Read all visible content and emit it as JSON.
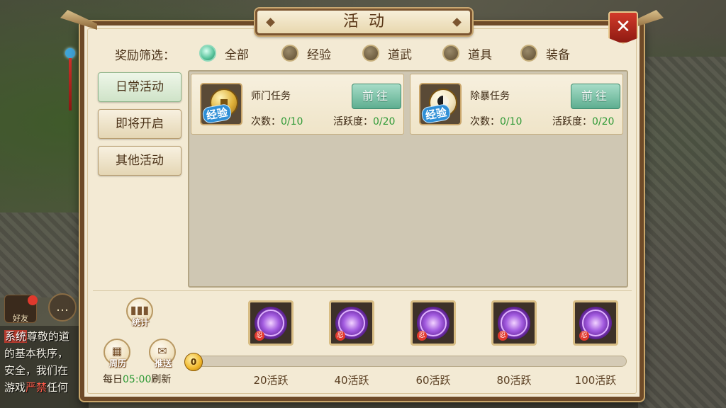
{
  "window": {
    "title": "活动",
    "close_icon": "close-icon",
    "accent_color": "#6e4a28"
  },
  "filter": {
    "label": "奖励筛选：",
    "options": [
      {
        "label": "全部",
        "selected": true
      },
      {
        "label": "经验",
        "selected": false
      },
      {
        "label": "道武",
        "selected": false
      },
      {
        "label": "道具",
        "selected": false
      },
      {
        "label": "装备",
        "selected": false
      }
    ]
  },
  "tabs": [
    {
      "label": "日常活动",
      "active": true
    },
    {
      "label": "即将开启",
      "active": false
    },
    {
      "label": "其他活动",
      "active": false
    }
  ],
  "activities": [
    {
      "name": "师门任务",
      "icon": "exp-coin-icon",
      "icon_badge": "经验",
      "button": "前往",
      "count_label": "次数：",
      "count_value": "0/10",
      "activity_label": "活跃度：",
      "activity_value": "0/20"
    },
    {
      "name": "除暴任务",
      "icon": "yinyang-coin-icon",
      "icon_badge": "经验",
      "button": "前往",
      "count_label": "次数：",
      "count_value": "0/10",
      "activity_label": "活跃度：",
      "activity_value": "0/20"
    }
  ],
  "bottom": {
    "stats_label": "统计",
    "calendar_label": "周历",
    "push_label": "推送",
    "refresh_prefix": "每日",
    "refresh_time": "05:00",
    "refresh_suffix": "刷新",
    "progress_value": "0",
    "progress_fraction": 0,
    "rewards": [
      {
        "label": "20活跃",
        "seal": "忍"
      },
      {
        "label": "40活跃",
        "seal": "忍"
      },
      {
        "label": "60活跃",
        "seal": "忍"
      },
      {
        "label": "80活跃",
        "seal": "忍"
      },
      {
        "label": "100活跃",
        "seal": "忍"
      }
    ]
  },
  "background": {
    "friend_label": "好友",
    "chat_icon": "chat-bubble-icon",
    "chat_lines": [
      {
        "tag": "系统",
        "text": "尊敬的道"
      },
      {
        "text": "的基本秩序，"
      },
      {
        "text": "安全，我们在"
      },
      {
        "pre": "游戏",
        "red": "严禁",
        "post": "任何"
      }
    ]
  }
}
